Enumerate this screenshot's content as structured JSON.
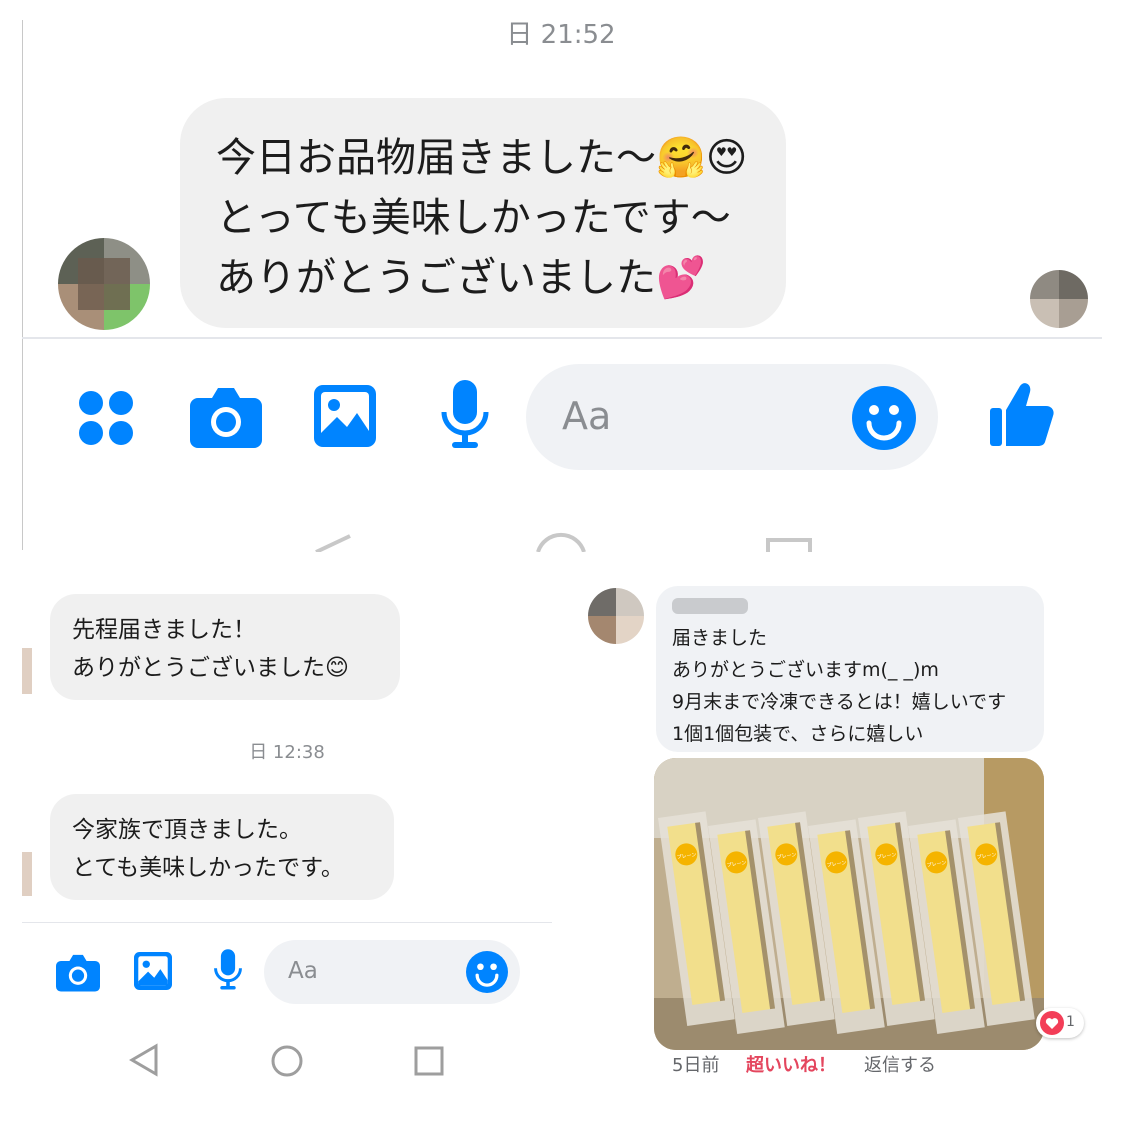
{
  "top": {
    "timestamp": "日 21:52",
    "message_lines": [
      "今日お品物届きました〜🤗😍",
      "とっても美味しかったです〜",
      "ありがとうございました💕"
    ],
    "composer_placeholder": "Aa",
    "icons": [
      "apps-icon",
      "camera-icon",
      "gallery-icon",
      "microphone-icon",
      "emoji-icon",
      "thumbs-up-icon"
    ],
    "accent_color": "#0084ff"
  },
  "bottom_left": {
    "messages": [
      {
        "lines": [
          "先程届きました！",
          "ありがとうございました😊"
        ]
      },
      {
        "lines": [
          "今家族で頂きました。",
          "とても美味しかったです。"
        ]
      }
    ],
    "timestamp": "日 12:38",
    "composer_placeholder": "Aa",
    "icons": [
      "camera-icon",
      "gallery-icon",
      "microphone-icon",
      "emoji-icon"
    ],
    "nav_icons": [
      "back-icon",
      "home-icon",
      "recents-icon"
    ]
  },
  "bottom_right": {
    "comment_lines": [
      "届きました",
      "ありがとうございますm(_ _)m",
      "9月末まで冷凍できるとは！嬉しいです",
      "1個1個包装で、さらに嬉しい"
    ],
    "photo_label": "プレーン",
    "reaction_count": "1",
    "time_ago": "5日前",
    "like_label": "超いいね！",
    "reply_label": "返信する",
    "like_color": "#e4465e"
  }
}
